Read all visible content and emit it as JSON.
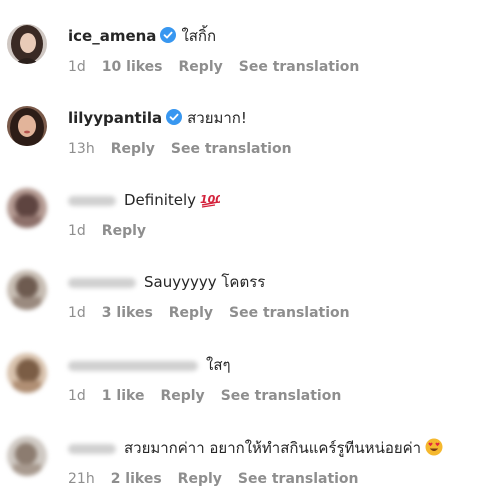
{
  "comments": [
    {
      "username": "ice_amena",
      "verified": true,
      "text": "ใสกิ้ก",
      "time": "1d",
      "likes": "10 likes",
      "reply": "Reply",
      "translate": "See translation"
    },
    {
      "username": "lilyypantila",
      "verified": true,
      "text": "สวยมาก!",
      "time": "13h",
      "reply": "Reply",
      "translate": "See translation"
    },
    {
      "username": "",
      "text": "Definitely",
      "emoji": "hundred-points-icon",
      "time": "1d",
      "reply": "Reply"
    },
    {
      "username": "",
      "text": "Sauyyyyy โคตรร",
      "time": "1d",
      "likes": "3 likes",
      "reply": "Reply",
      "translate": "See translation"
    },
    {
      "username": "",
      "text": "ใสๆ",
      "time": "1d",
      "likes": "1 like",
      "reply": "Reply",
      "translate": "See translation"
    },
    {
      "username": "",
      "text": "สวยมากค่าา อยากให้ทำสกินแคร์รูทีนหน่อยค่า",
      "emoji": "heart-eyes-icon",
      "time": "21h",
      "likes": "2 likes",
      "reply": "Reply",
      "translate": "See translation"
    }
  ],
  "colors": {
    "text": "#262626",
    "meta": "#8e8e8e",
    "verified": "#3897f0"
  }
}
